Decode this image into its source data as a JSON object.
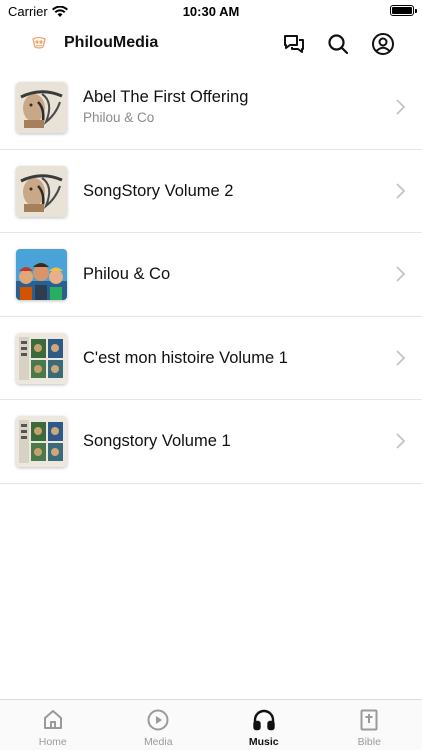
{
  "status_bar": {
    "carrier": "Carrier",
    "time": "10:30 AM"
  },
  "header": {
    "title": "PhilouMedia",
    "icons": [
      "chat-icon",
      "search-icon",
      "account-icon"
    ]
  },
  "albums": [
    {
      "title": "Abel The First Offering",
      "subtitle": "Philou & Co",
      "cover": "abel-cover"
    },
    {
      "title": "SongStory Volume 2",
      "subtitle": "",
      "cover": "songstory-v2-cover"
    },
    {
      "title": "Philou & Co",
      "subtitle": "",
      "cover": "philou-co-cover"
    },
    {
      "title": "C'est mon histoire Volume 1",
      "subtitle": "",
      "cover": "cest-mon-histoire-cover"
    },
    {
      "title": "Songstory Volume 1",
      "subtitle": "",
      "cover": "songstory-v1-cover"
    }
  ],
  "tabs": [
    {
      "label": "Home",
      "icon": "home-icon",
      "active": false
    },
    {
      "label": "Media",
      "icon": "play-icon",
      "active": false
    },
    {
      "label": "Music",
      "icon": "headphones-icon",
      "active": true
    },
    {
      "label": "Bible",
      "icon": "bible-icon",
      "active": false
    }
  ],
  "colors": {
    "accent_logo": "#f3a46a",
    "text": "#111111",
    "subtitle": "#8a8a8a",
    "divider": "#e6e6e6",
    "inactive_tab": "#9a9a9a"
  }
}
